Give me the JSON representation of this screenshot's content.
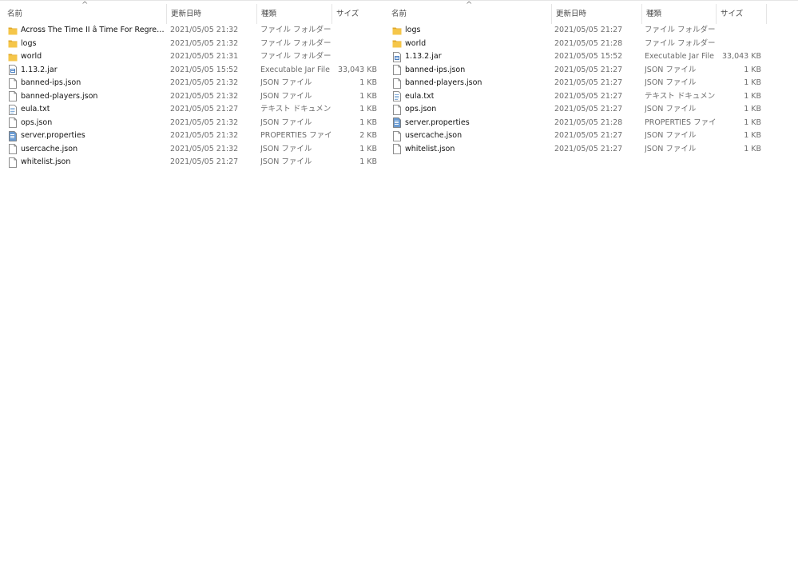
{
  "left_pane": {
    "columns": {
      "name": "名前",
      "date": "更新日時",
      "type": "種類",
      "size": "サイズ"
    },
    "rows": [
      {
        "icon": "folder-icon",
        "name": "Across The Time II â Time For Regrets (rel...",
        "date": "2021/05/05 21:32",
        "type": "ファイル フォルダー",
        "size": ""
      },
      {
        "icon": "folder-icon",
        "name": "logs",
        "date": "2021/05/05 21:32",
        "type": "ファイル フォルダー",
        "size": ""
      },
      {
        "icon": "folder-icon",
        "name": "world",
        "date": "2021/05/05 21:31",
        "type": "ファイル フォルダー",
        "size": ""
      },
      {
        "icon": "jar-file-icon",
        "name": "1.13.2.jar",
        "date": "2021/05/05 15:52",
        "type": "Executable Jar File",
        "size": "33,043 KB"
      },
      {
        "icon": "file-icon",
        "name": "banned-ips.json",
        "date": "2021/05/05 21:32",
        "type": "JSON ファイル",
        "size": "1 KB"
      },
      {
        "icon": "file-icon",
        "name": "banned-players.json",
        "date": "2021/05/05 21:32",
        "type": "JSON ファイル",
        "size": "1 KB"
      },
      {
        "icon": "text-file-icon",
        "name": "eula.txt",
        "date": "2021/05/05 21:27",
        "type": "テキスト ドキュメント",
        "size": "1 KB"
      },
      {
        "icon": "file-icon",
        "name": "ops.json",
        "date": "2021/05/05 21:32",
        "type": "JSON ファイル",
        "size": "1 KB"
      },
      {
        "icon": "properties-file-icon",
        "name": "server.properties",
        "date": "2021/05/05 21:32",
        "type": "PROPERTIES ファイル",
        "size": "2 KB"
      },
      {
        "icon": "file-icon",
        "name": "usercache.json",
        "date": "2021/05/05 21:32",
        "type": "JSON ファイル",
        "size": "1 KB"
      },
      {
        "icon": "file-icon",
        "name": "whitelist.json",
        "date": "2021/05/05 21:27",
        "type": "JSON ファイル",
        "size": "1 KB"
      }
    ]
  },
  "right_pane": {
    "columns": {
      "name": "名前",
      "date": "更新日時",
      "type": "種類",
      "size": "サイズ"
    },
    "rows": [
      {
        "icon": "folder-icon",
        "name": "logs",
        "date": "2021/05/05 21:27",
        "type": "ファイル フォルダー",
        "size": ""
      },
      {
        "icon": "folder-icon",
        "name": "world",
        "date": "2021/05/05 21:28",
        "type": "ファイル フォルダー",
        "size": ""
      },
      {
        "icon": "jar-file-icon",
        "name": "1.13.2.jar",
        "date": "2021/05/05 15:52",
        "type": "Executable Jar File",
        "size": "33,043 KB"
      },
      {
        "icon": "file-icon",
        "name": "banned-ips.json",
        "date": "2021/05/05 21:27",
        "type": "JSON ファイル",
        "size": "1 KB"
      },
      {
        "icon": "file-icon",
        "name": "banned-players.json",
        "date": "2021/05/05 21:27",
        "type": "JSON ファイル",
        "size": "1 KB"
      },
      {
        "icon": "text-file-icon",
        "name": "eula.txt",
        "date": "2021/05/05 21:27",
        "type": "テキスト ドキュメント",
        "size": "1 KB"
      },
      {
        "icon": "file-icon",
        "name": "ops.json",
        "date": "2021/05/05 21:27",
        "type": "JSON ファイル",
        "size": "1 KB"
      },
      {
        "icon": "properties-file-icon",
        "name": "server.properties",
        "date": "2021/05/05 21:28",
        "type": "PROPERTIES ファイル",
        "size": "1 KB"
      },
      {
        "icon": "file-icon",
        "name": "usercache.json",
        "date": "2021/05/05 21:27",
        "type": "JSON ファイル",
        "size": "1 KB"
      },
      {
        "icon": "file-icon",
        "name": "whitelist.json",
        "date": "2021/05/05 21:27",
        "type": "JSON ファイル",
        "size": "1 KB"
      }
    ]
  },
  "colors": {
    "folder": "#f5c64a",
    "folder_dark": "#e0a92c",
    "file_border": "#6f6f6f",
    "jar_blue": "#4a7fc1",
    "properties_blue": "#6b9bd1",
    "text_lines": "#7aa7d6"
  }
}
